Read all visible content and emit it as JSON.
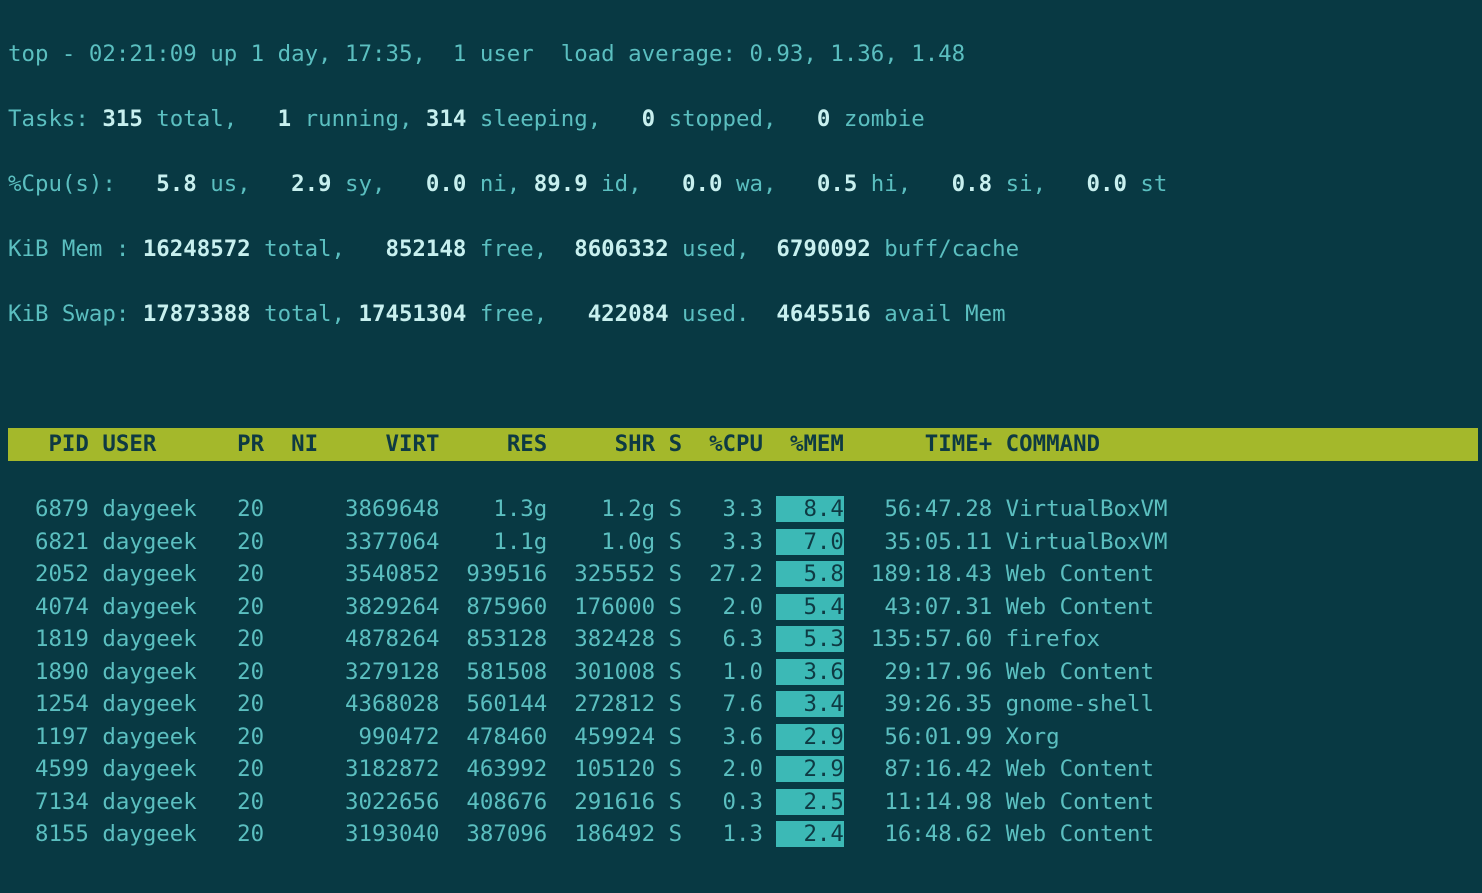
{
  "summary": {
    "time": "02:21:09",
    "uptime": "1 day, 17:35",
    "users": "1 user",
    "load": "0.93, 1.36, 1.48"
  },
  "tasks": {
    "total": "315",
    "running": "1",
    "sleeping": "314",
    "stopped": "0",
    "zombie": "0"
  },
  "cpu": {
    "us": "5.8",
    "sy": "2.9",
    "ni": "0.0",
    "id": "89.9",
    "wa": "0.0",
    "hi": "0.5",
    "si": "0.8",
    "st": "0.0"
  },
  "mem": {
    "total": "16248572",
    "free": "852148",
    "used": "8606332",
    "buff": "6790092"
  },
  "swap": {
    "total": "17873388",
    "free": "17451304",
    "used": "422084",
    "avail": "4645516"
  },
  "labels": {
    "top": "top - ",
    "up": " up ",
    "load_avg": "  load average: ",
    "tasks": "Tasks: ",
    "total": " total,",
    "running": " running,",
    "sleeping": " sleeping,",
    "stopped": " stopped,",
    "zombie": " zombie",
    "cpu": "%Cpu(s):",
    "us": " us,",
    "sy": " sy,",
    "ni": " ni,",
    "id": " id,",
    "wa": " wa,",
    "hi": " hi,",
    "si": " si,",
    "st": " st",
    "mem": "KiB Mem : ",
    "free": " free,",
    "used": " used,",
    "used_dot": " used.",
    "buff": " buff/cache",
    "swap": "KiB Swap: ",
    "avail": " avail Mem",
    "comma": ",  "
  },
  "columns": {
    "pid": "PID",
    "user": "USER",
    "pr": "PR",
    "ni": "NI",
    "virt": "VIRT",
    "res": "RES",
    "shr": "SHR",
    "s": "S",
    "cpu": "%CPU",
    "mem": "%MEM",
    "time": "TIME+",
    "command": "COMMAND"
  },
  "processes": [
    {
      "pid": "6879",
      "user": "daygeek",
      "pr": "20",
      "ni": "",
      "virt": "3869648",
      "res": "1.3g",
      "shr": "1.2g",
      "s": "S",
      "cpu": "3.3",
      "mem": "8.4",
      "time": "56:47.28",
      "command": "VirtualBoxVM"
    },
    {
      "pid": "6821",
      "user": "daygeek",
      "pr": "20",
      "ni": "",
      "virt": "3377064",
      "res": "1.1g",
      "shr": "1.0g",
      "s": "S",
      "cpu": "3.3",
      "mem": "7.0",
      "time": "35:05.11",
      "command": "VirtualBoxVM"
    },
    {
      "pid": "2052",
      "user": "daygeek",
      "pr": "20",
      "ni": "",
      "virt": "3540852",
      "res": "939516",
      "shr": "325552",
      "s": "S",
      "cpu": "27.2",
      "mem": "5.8",
      "time": "189:18.43",
      "command": "Web Content"
    },
    {
      "pid": "4074",
      "user": "daygeek",
      "pr": "20",
      "ni": "",
      "virt": "3829264",
      "res": "875960",
      "shr": "176000",
      "s": "S",
      "cpu": "2.0",
      "mem": "5.4",
      "time": "43:07.31",
      "command": "Web Content"
    },
    {
      "pid": "1819",
      "user": "daygeek",
      "pr": "20",
      "ni": "",
      "virt": "4878264",
      "res": "853128",
      "shr": "382428",
      "s": "S",
      "cpu": "6.3",
      "mem": "5.3",
      "time": "135:57.60",
      "command": "firefox"
    },
    {
      "pid": "1890",
      "user": "daygeek",
      "pr": "20",
      "ni": "",
      "virt": "3279128",
      "res": "581508",
      "shr": "301008",
      "s": "S",
      "cpu": "1.0",
      "mem": "3.6",
      "time": "29:17.96",
      "command": "Web Content"
    },
    {
      "pid": "1254",
      "user": "daygeek",
      "pr": "20",
      "ni": "",
      "virt": "4368028",
      "res": "560144",
      "shr": "272812",
      "s": "S",
      "cpu": "7.6",
      "mem": "3.4",
      "time": "39:26.35",
      "command": "gnome-shell"
    },
    {
      "pid": "1197",
      "user": "daygeek",
      "pr": "20",
      "ni": "",
      "virt": "990472",
      "res": "478460",
      "shr": "459924",
      "s": "S",
      "cpu": "3.6",
      "mem": "2.9",
      "time": "56:01.99",
      "command": "Xorg"
    },
    {
      "pid": "4599",
      "user": "daygeek",
      "pr": "20",
      "ni": "",
      "virt": "3182872",
      "res": "463992",
      "shr": "105120",
      "s": "S",
      "cpu": "2.0",
      "mem": "2.9",
      "time": "87:16.42",
      "command": "Web Content"
    },
    {
      "pid": "7134",
      "user": "daygeek",
      "pr": "20",
      "ni": "",
      "virt": "3022656",
      "res": "408676",
      "shr": "291616",
      "s": "S",
      "cpu": "0.3",
      "mem": "2.5",
      "time": "11:14.98",
      "command": "Web Content"
    },
    {
      "pid": "8155",
      "user": "daygeek",
      "pr": "20",
      "ni": "",
      "virt": "3193040",
      "res": "387096",
      "shr": "186492",
      "s": "S",
      "cpu": "1.3",
      "mem": "2.4",
      "time": "16:48.62",
      "command": "Web Content"
    }
  ]
}
